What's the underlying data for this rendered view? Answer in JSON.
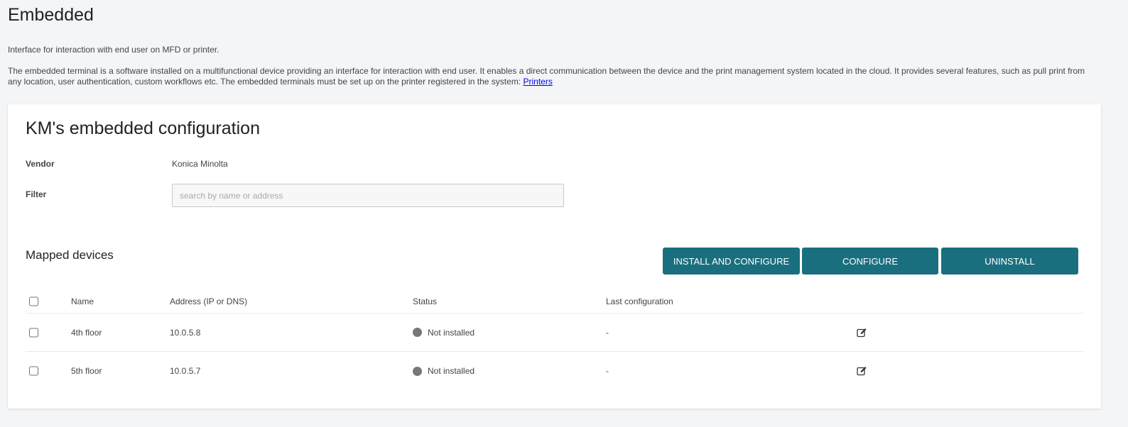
{
  "page": {
    "title": "Embedded",
    "subtitle": "Interface for interaction with end user on MFD or printer.",
    "description": "The embedded terminal is a software installed on a multifunctional device providing an interface for interaction with end user. It enables a direct communication between the device and the print management system located in the cloud. It provides several features, such as pull print from any location, user authentication, custom workflows etc. The embedded terminals must be set up on the printer registered in the system: ",
    "description_link": "Printers"
  },
  "config": {
    "title": "KM's embedded configuration",
    "vendor_label": "Vendor",
    "vendor_value": "Konica Minolta",
    "filter_label": "Filter",
    "filter_placeholder": "search by name or address",
    "filter_value": ""
  },
  "mapped": {
    "title": "Mapped devices",
    "buttons": {
      "install": "INSTALL AND CONFIGURE",
      "configure": "CONFIGURE",
      "uninstall": "UNINSTALL"
    },
    "columns": [
      "Name",
      "Address (IP or DNS)",
      "Status",
      "Last configuration"
    ],
    "rows": [
      {
        "name": "4th floor",
        "address": "10.0.5.8",
        "status": "Not installed",
        "last": "-"
      },
      {
        "name": "5th floor",
        "address": "10.0.5.7",
        "status": "Not installed",
        "last": "-"
      }
    ]
  },
  "colors": {
    "button": "#1a6f7f",
    "status_dot": "#777777",
    "background": "#f4f5f7"
  },
  "icons": {
    "edit": "edit-icon"
  }
}
